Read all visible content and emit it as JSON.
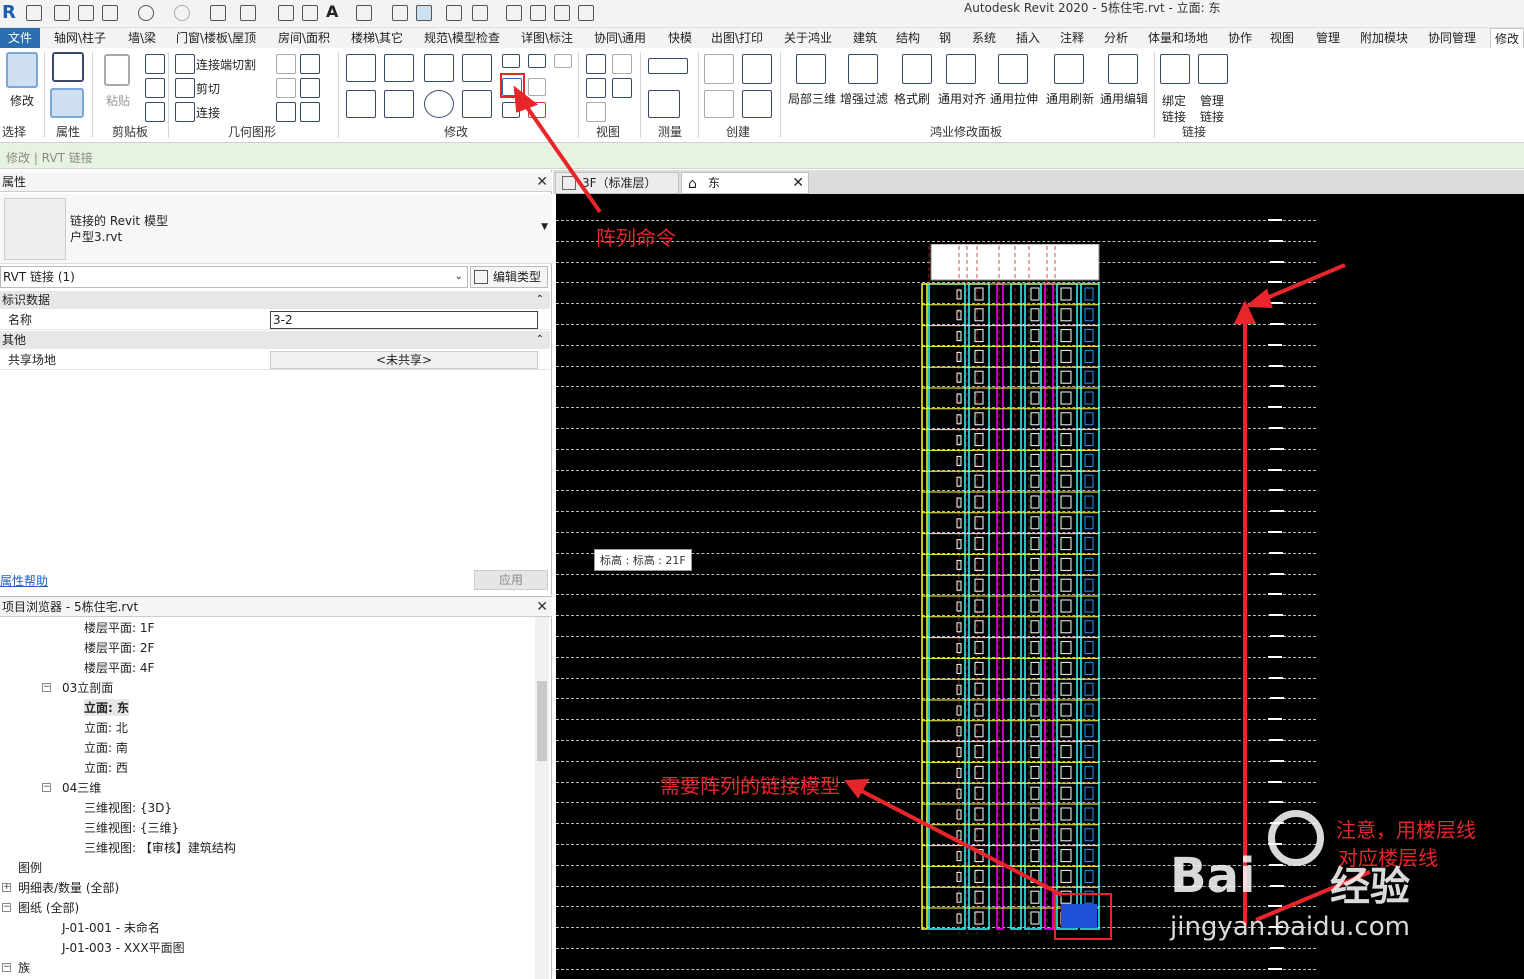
{
  "window": {
    "title": "Autodesk Revit 2020 - 5栋住宅.rvt - 立面: 东"
  },
  "ribbon_tabs": [
    "文件",
    "轴网\\柱子",
    "墙\\梁",
    "门窗\\楼板\\屋顶",
    "房间\\面积",
    "楼梯\\其它",
    "规范\\模型检查",
    "详图\\标注",
    "协同\\通用",
    "快模",
    "出图\\打印",
    "关于鸿业",
    "建筑",
    "结构",
    "钢",
    "系统",
    "插入",
    "注释",
    "分析",
    "体量和场地",
    "协作",
    "视图",
    "管理",
    "附加模块",
    "协同管理",
    "修改"
  ],
  "ribbon": {
    "modify_label": "修改",
    "paste_label": "粘贴",
    "geometry_items": [
      "连接端切割",
      "剪切",
      "连接"
    ],
    "panels": [
      "选择",
      "属性",
      "剪贴板",
      "几何图形",
      "修改",
      "视图",
      "测量",
      "创建",
      "鸿业修改面板",
      "链接"
    ],
    "hy_buttons": [
      "局部三维",
      "增强过滤",
      "格式刷",
      "通用对齐",
      "通用拉伸",
      "通用刷新",
      "通用编辑"
    ],
    "link_buttons": [
      [
        "绑定",
        "链接"
      ],
      [
        "管理",
        "链接"
      ]
    ]
  },
  "context_bar": "修改 | RVT 链接",
  "properties": {
    "title": "属性",
    "type_line1": "链接的 Revit 模型",
    "type_line2": "户型3.rvt",
    "instance_filter": "RVT 链接 (1)",
    "edit_type": "编辑类型",
    "group_identity": "标识数据",
    "name_key": "名称",
    "name_value": "3-2",
    "group_other": "其他",
    "shared_site_key": "共享场地",
    "shared_site_value": "<未共享>",
    "help_link": "属性帮助",
    "apply": "应用"
  },
  "browser": {
    "title": "项目浏览器 - 5栋住宅.rvt",
    "items": [
      {
        "text": "楼层平面: 1F",
        "level": 3
      },
      {
        "text": "楼层平面: 2F",
        "level": 3
      },
      {
        "text": "楼层平面: 4F",
        "level": 3
      },
      {
        "text": "03立剖面",
        "level": 2,
        "toggle": "−"
      },
      {
        "text": "立面: 东",
        "level": 3,
        "selected": true
      },
      {
        "text": "立面: 北",
        "level": 3
      },
      {
        "text": "立面: 南",
        "level": 3
      },
      {
        "text": "立面: 西",
        "level": 3
      },
      {
        "text": "04三维",
        "level": 2,
        "toggle": "−"
      },
      {
        "text": "三维视图: {3D}",
        "level": 3
      },
      {
        "text": "三维视图: {三维}",
        "level": 3
      },
      {
        "text": "三维视图: 【审核】建筑结构",
        "level": 3
      },
      {
        "text": "图例",
        "level": 1
      },
      {
        "text": "明细表/数量 (全部)",
        "level": 1,
        "toggle": "+"
      },
      {
        "text": "图纸 (全部)",
        "level": 1,
        "toggle": "−"
      },
      {
        "text": "J-01-001 - 未命名",
        "level": 2
      },
      {
        "text": "J-01-003 - XXX平面图",
        "level": 2
      },
      {
        "text": "族",
        "level": 1,
        "toggle": "−"
      }
    ]
  },
  "view_tabs": [
    "3F（标准层）",
    "东"
  ],
  "canvas": {
    "tooltip": "标高 : 标高 : 21F"
  },
  "annotations": {
    "array_cmd": "阵列命令",
    "link_model": "需要阵列的链接模型",
    "note_line1": "注意，用楼层线",
    "note_line2": "对应楼层线"
  },
  "watermark": {
    "brand": "Bai",
    "brand2": "经验",
    "url": "jingyan.baidu.com"
  },
  "colors": {
    "accent": "#2a6db0",
    "annotation": "#e8252a",
    "canvas_bg": "#000000"
  }
}
